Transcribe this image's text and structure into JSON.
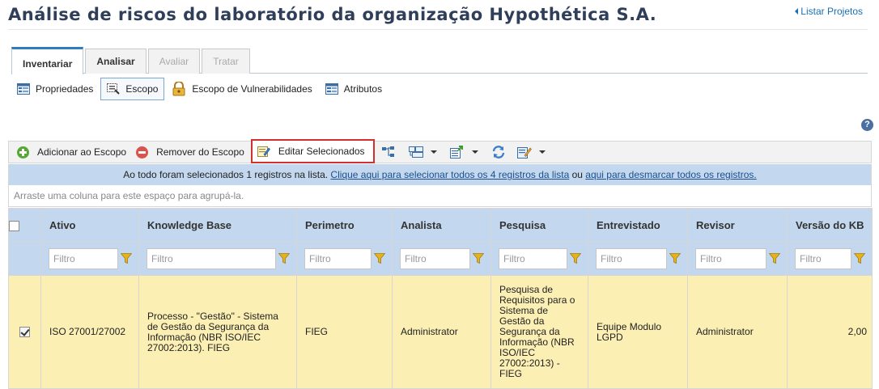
{
  "page": {
    "title": "Análise de riscos do laboratório da organização Hypothética S.A.",
    "back_link": "Listar Projetos"
  },
  "tabs": [
    {
      "label": "Inventariar",
      "state": "active"
    },
    {
      "label": "Analisar",
      "state": "enabled"
    },
    {
      "label": "Avaliar",
      "state": "disabled"
    },
    {
      "label": "Tratar",
      "state": "disabled"
    }
  ],
  "subnav": [
    {
      "label": "Propriedades",
      "icon": "properties-icon"
    },
    {
      "label": "Escopo",
      "icon": "scope-icon",
      "selected": true
    },
    {
      "label": "Escopo de Vulnerabilidades",
      "icon": "vulnerability-scope-icon"
    },
    {
      "label": "Atributos",
      "icon": "attributes-icon"
    }
  ],
  "help": {
    "label": "?"
  },
  "toolbar": {
    "add_label": "Adicionar ao Escopo",
    "remove_label": "Remover do Escopo",
    "edit_selected_label": "Editar Selecionados",
    "icons": [
      "hierarchy-icon",
      "group-icon",
      "export-icon",
      "refresh-icon",
      "edit-icon"
    ]
  },
  "selection_info": {
    "prefix": "Ao todo foram selecionados 1 registros na lista. ",
    "select_all_link": "Clique aqui para selecionar todos os 4 registros da lista",
    "middle": " ou ",
    "deselect_link": "aqui para desmarcar todos os registros."
  },
  "group_hint": "Arraste uma coluna para este espaço para agrupá-la.",
  "grid": {
    "columns": [
      "Ativo",
      "Knowledge Base",
      "Perimetro",
      "Analista",
      "Pesquisa",
      "Entrevistado",
      "Revisor",
      "Versão do KB"
    ],
    "filter_placeholder": "Filtro",
    "rows": [
      {
        "selected": true,
        "ativo": "ISO 27001/27002",
        "knowledge_base": "Processo - \"Gestão\" - Sistema de Gestão da Segurança da Informação (NBR ISO/IEC 27002:2013). FIEG",
        "perimetro": "FIEG",
        "analista": "Administrator",
        "pesquisa": "Pesquisa de Requisitos para o Sistema de Gestão da Segurança da Informação (NBR ISO/IEC 27002:2013) - FIEG",
        "entrevistado": "Equipe Modulo LGPD",
        "revisor": "Administrator",
        "versao_kb": "2,00"
      }
    ]
  },
  "colors": {
    "title": "#2f3f5a",
    "link": "#1a6fb5",
    "tab_accent": "#2e7dc2",
    "grid_header": "#c3d8ee",
    "selected_row": "#fbefb4",
    "highlight_border": "#d32f2f"
  }
}
